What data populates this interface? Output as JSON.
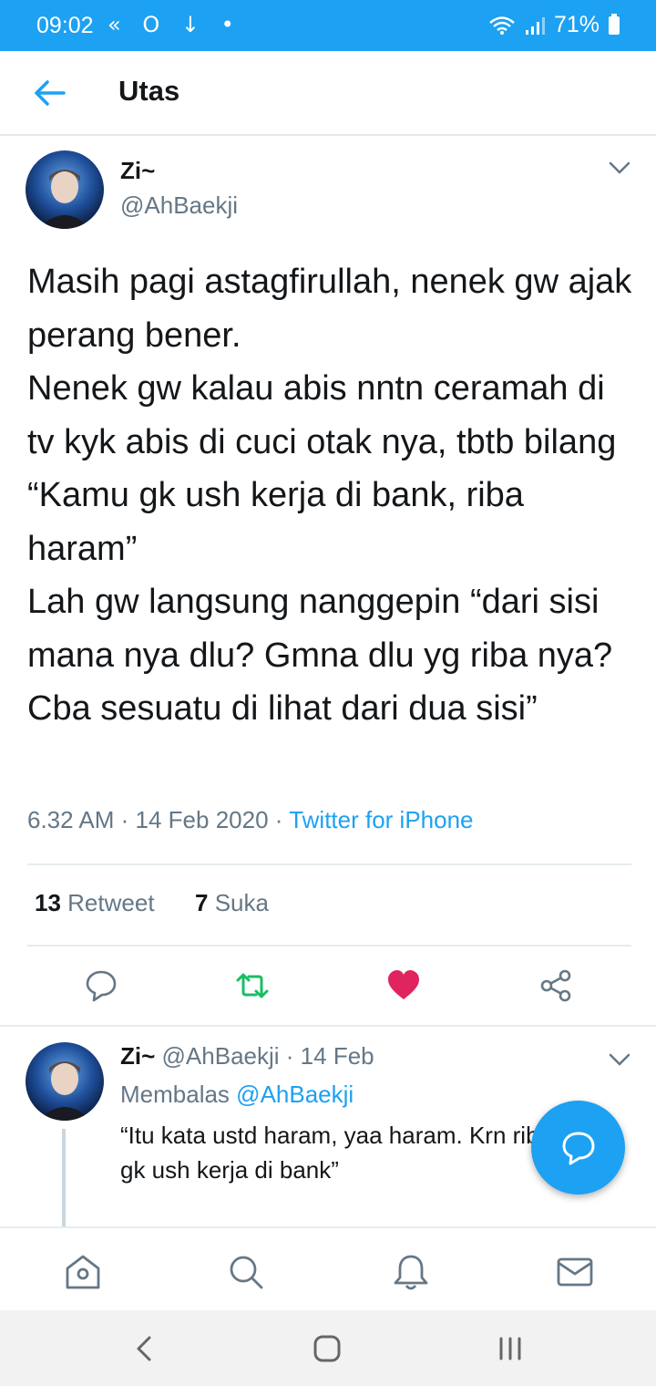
{
  "status_bar": {
    "time": "09:02",
    "left_icons": "« O ↓ •",
    "battery": "71%"
  },
  "header": {
    "title": "Utas"
  },
  "tweet": {
    "name": "Zi~",
    "handle": "@AhBaekji",
    "text": "Masih pagi astagfirullah, nenek gw ajak perang bener.\nNenek gw kalau abis nntn ceramah di tv kyk abis di cuci otak nya, tbtb bilang “Kamu gk ush kerja di bank, riba haram”\nLah gw langsung nanggepin “dari sisi mana nya dlu? Gmna dlu yg riba nya? Cba sesuatu di lihat dari dua sisi”",
    "time": "6.32 AM",
    "date": "14 Feb 2020",
    "source": "Twitter for iPhone",
    "retweet_count": "13",
    "retweet_label": "Retweet",
    "like_count": "7",
    "like_label": "Suka"
  },
  "reply": {
    "name": "Zi~",
    "handle": "@AhBaekji",
    "date": "14 Feb",
    "replying_prefix": "Membalas",
    "replying_to": "@AhBaekji",
    "text": "“Itu kata ustd haram, yaa haram. Krn riba, kamu gk ush kerja di bank”"
  },
  "colors": {
    "brand": "#1da1f2",
    "like": "#e0245e",
    "retweet": "#17bf63",
    "secondary_text": "#657786"
  }
}
